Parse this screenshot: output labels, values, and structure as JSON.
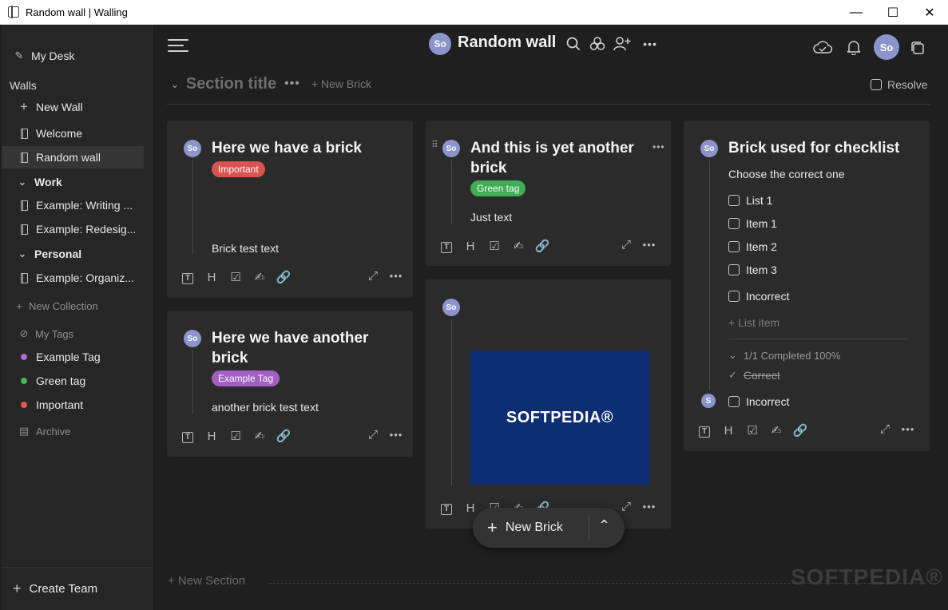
{
  "window": {
    "title": "Random wall | Walling",
    "controls": {
      "minimize": "—",
      "maximize": "☐",
      "close": "✕"
    }
  },
  "sidebar": {
    "my_desk": "My Desk",
    "walls_heading": "Walls",
    "new_wall": "New Wall",
    "walls": [
      "Welcome",
      "Random wall"
    ],
    "collections": [
      {
        "name": "Work",
        "items": [
          "Example: Writing ...",
          "Example: Redesig..."
        ]
      },
      {
        "name": "Personal",
        "items": [
          "Example: Organiz..."
        ]
      }
    ],
    "new_collection": "New Collection",
    "my_tags": "My Tags",
    "tags": [
      {
        "name": "Example Tag",
        "color": "#b06ad0"
      },
      {
        "name": "Green tag",
        "color": "#3fb950"
      },
      {
        "name": "Important",
        "color": "#e5534b"
      }
    ],
    "archive": "Archive",
    "create_team": "Create Team"
  },
  "topbar": {
    "avatar_initials": "So",
    "wall_title": "Random wall",
    "more": "•••"
  },
  "section": {
    "title": "Section title",
    "more": "•••",
    "new_brick": "+ New Brick",
    "resolve": "Resolve"
  },
  "cards": {
    "card1": {
      "avatar": "So",
      "title": "Here we have a brick",
      "tag": {
        "label": "Important",
        "color": "#d9534f"
      },
      "text": "Brick test text"
    },
    "card2": {
      "avatar": "So",
      "title": "Here we have another brick",
      "tag": {
        "label": "Example Tag",
        "color": "#a25fc4"
      },
      "text": "another brick test text"
    },
    "card3": {
      "avatar": "So",
      "title": "And this is yet another brick",
      "tag": {
        "label": "Green tag",
        "color": "#3fae55"
      },
      "text": "Just text"
    },
    "card4": {
      "avatar": "So",
      "image_text": "SOFTPEDIA®"
    },
    "card5": {
      "avatar": "So",
      "title": "Brick used for checklist",
      "subtitle": "Choose the correct one",
      "items": [
        "List 1",
        "Item 1",
        "Item 2",
        "Item 3"
      ],
      "incorrect_1": "Incorrect",
      "list_item": "+ List item",
      "completed": "1/1 Completed 100%",
      "correct": "Correct",
      "incorrect_2": "Incorrect",
      "bottom_avatar": "S"
    },
    "more": "•••"
  },
  "fab": {
    "label": "New Brick"
  },
  "new_section": "+ New Section",
  "watermark": "SOFTPEDIA®"
}
